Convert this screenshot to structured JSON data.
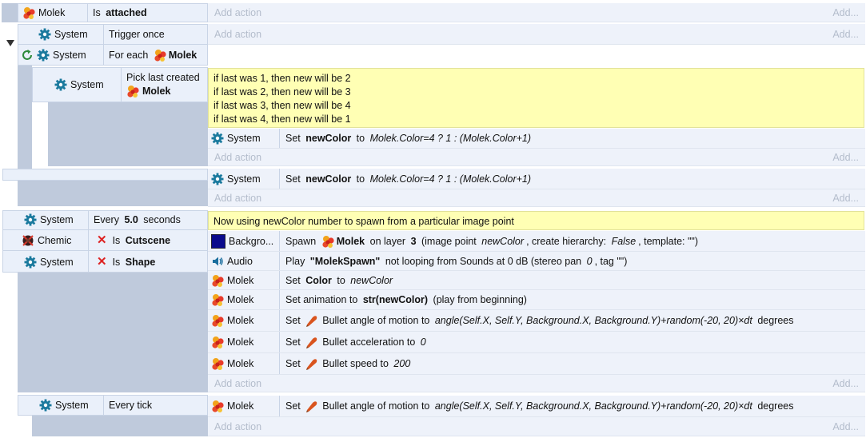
{
  "colors": {
    "margin": "#bfcadc",
    "condition_bg": "#eaf0fa",
    "action_bg": "#eef2fa",
    "comment_bg": "#ffffb4",
    "add_action_text": "#b4bdcc",
    "gear": "#1b7a9e",
    "invert": "#dd2222"
  },
  "add_action_label": "Add action",
  "add_label": "Add...",
  "events": {
    "e1": {
      "cond": {
        "object": "Molek",
        "text_pre": "Is ",
        "text_bold": "attached"
      }
    },
    "e2": {
      "cond1": {
        "object": "System",
        "text": "Trigger once"
      },
      "cond2": {
        "object": "System",
        "text_pre": "For each ",
        "text_obj": "Molek"
      }
    },
    "e3": {
      "cond": {
        "object": "System",
        "text_line1": "Pick last created",
        "text_obj": "Molek"
      },
      "comment": [
        "if last was 1, then new will be 2",
        "if last was 2, then new will be 3",
        "if last was 3, then new will be 4",
        "if last was 4, then new will be 1"
      ],
      "action": {
        "object": "System",
        "pre": "Set ",
        "var": "newColor",
        "mid": " to ",
        "expr": "Molek.Color=4 ? 1 : (Molek.Color+1)"
      }
    },
    "e4": {
      "action": {
        "object": "System",
        "pre": "Set ",
        "var": "newColor",
        "mid": " to ",
        "expr": "Molek.Color=4 ? 1 : (Molek.Color+1)"
      }
    },
    "e5": {
      "cond1": {
        "object": "System",
        "text_pre": "Every ",
        "text_bold": "5.0",
        "text_post": " seconds"
      },
      "cond2": {
        "object": "Chemic",
        "text_pre": "Is ",
        "text_bold": "Cutscene",
        "invert": "✕"
      },
      "cond3": {
        "object": "System",
        "text_pre": "Is ",
        "text_bold": "Shape",
        "invert": "✕"
      },
      "comment": "Now using newColor number to spawn from a particular image point",
      "a1": {
        "object": "Backgro...",
        "t1": "Spawn ",
        "obj": "Molek",
        "t2": " on layer ",
        "layer": "3",
        "t3": " (image point ",
        "ip": "newColor",
        "t4": ", create hierarchy: ",
        "ch": "False",
        "t5": ", template: \"\")"
      },
      "a2": {
        "object": "Audio",
        "t1": "Play ",
        "sound": "\"MolekSpawn\"",
        "t2": " not looping from Sounds at 0 dB (stereo pan ",
        "pan": "0",
        "t3": ", tag \"\")"
      },
      "a3": {
        "object": "Molek",
        "t1": "Set ",
        "prop": "Color",
        "t2": " to ",
        "val": "newColor"
      },
      "a4": {
        "object": "Molek",
        "t1": "Set animation to ",
        "val": "str(newColor)",
        "t2": " (play from beginning)"
      },
      "a5": {
        "object": "Molek",
        "t1": "Set ",
        "t2": "Bullet angle of motion to ",
        "val": "angle(Self.X, Self.Y, Background.X, Background.Y)+random(-20, 20)×dt",
        "t3": " degrees"
      },
      "a6": {
        "object": "Molek",
        "t1": "Set ",
        "t2": "Bullet acceleration to ",
        "val": "0"
      },
      "a7": {
        "object": "Molek",
        "t1": "Set ",
        "t2": "Bullet speed to ",
        "val": "200"
      }
    },
    "e6": {
      "cond": {
        "object": "System",
        "text": "Every tick"
      },
      "action": {
        "object": "Molek",
        "t1": "Set ",
        "t2": "Bullet angle of motion to ",
        "val": "angle(Self.X, Self.Y, Background.X, Background.Y)+random(-20, 20)×dt",
        "t3": " degrees"
      }
    }
  }
}
